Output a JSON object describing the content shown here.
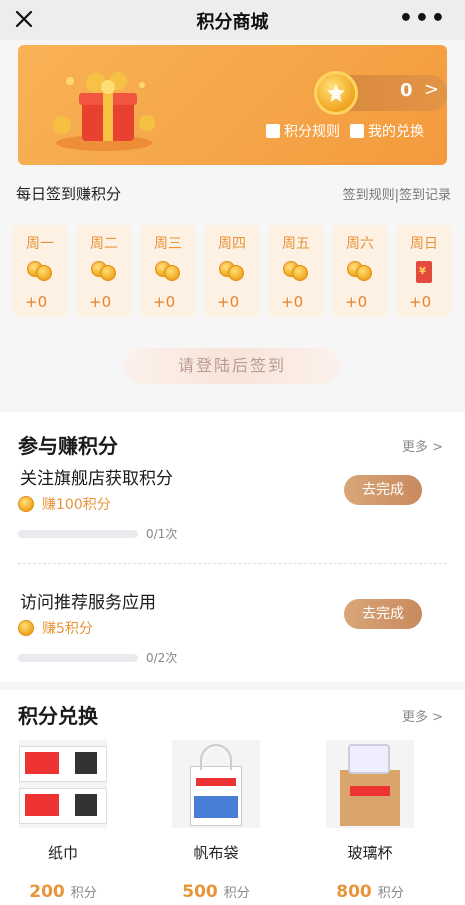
{
  "topbar": {
    "title": "积分商城",
    "more": "•••"
  },
  "banner": {
    "points": "0",
    "rules_label": "积分规则",
    "exchange_label": "我的兑换"
  },
  "signin": {
    "heading": "每日签到赚积分",
    "links": "签到规则|签到记录",
    "days": [
      {
        "name": "周一",
        "points": "+0"
      },
      {
        "name": "周二",
        "points": "+0"
      },
      {
        "name": "周三",
        "points": "+0"
      },
      {
        "name": "周四",
        "points": "+0"
      },
      {
        "name": "周五",
        "points": "+0"
      },
      {
        "name": "周六",
        "points": "+0"
      },
      {
        "name": "周日",
        "points": "+0"
      }
    ],
    "button": "请登陆后签到"
  },
  "earn": {
    "title": "参与赚积分",
    "more": "更多",
    "tasks": [
      {
        "title": "关注旗舰店获取积分",
        "reward": "赚100积分",
        "progress": "0/1次",
        "action": "去完成"
      },
      {
        "title": "访问推荐服务应用",
        "reward": "赚5积分",
        "progress": "0/2次",
        "action": "去完成"
      }
    ]
  },
  "exchange": {
    "title": "积分兑换",
    "more": "更多",
    "products": [
      {
        "name": "纸巾",
        "points": "200",
        "unit": "积分"
      },
      {
        "name": "帆布袋",
        "points": "500",
        "unit": "积分"
      },
      {
        "name": "玻璃杯",
        "points": "800",
        "unit": "积分"
      }
    ]
  }
}
